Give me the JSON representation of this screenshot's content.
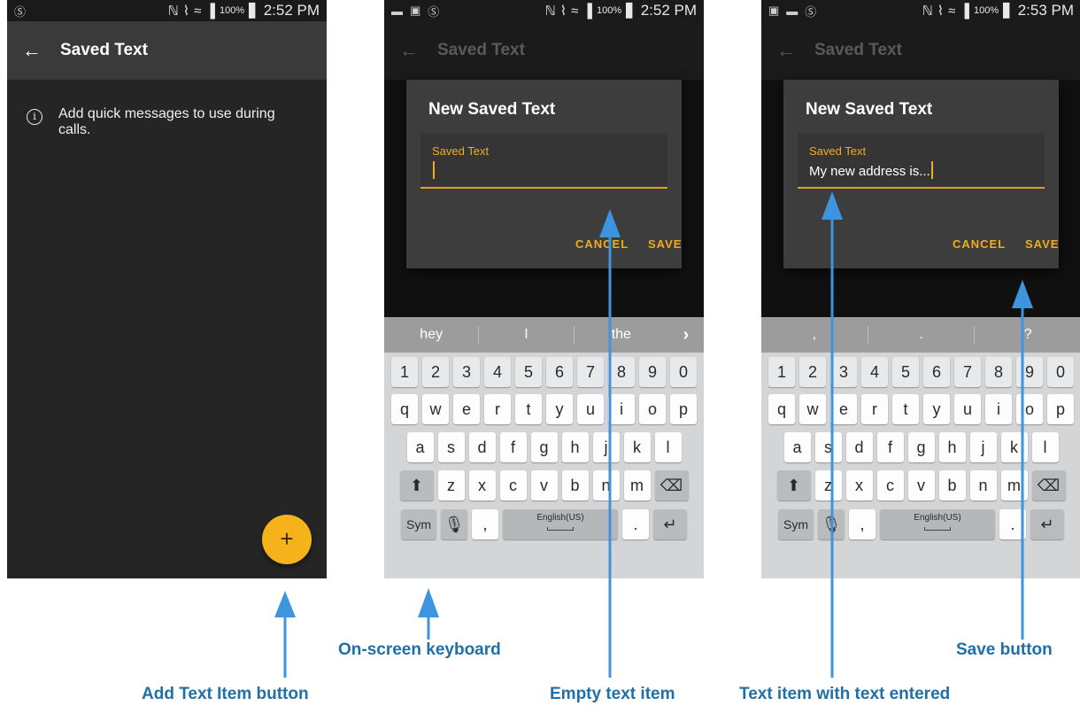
{
  "colors": {
    "accent": "#f5b21b",
    "annotation": "#3d95e0",
    "annotation_text": "#1f6fa8"
  },
  "screens": [
    {
      "status": {
        "time": "2:52 PM",
        "battery": "100%"
      },
      "appbar": {
        "back_icon": "arrow-left-icon",
        "title": "Saved Text"
      },
      "info_text": "Add quick messages to use during calls.",
      "fab_label": "+"
    },
    {
      "status": {
        "time": "2:52 PM",
        "battery": "100%"
      },
      "appbar": {
        "back_icon": "arrow-left-icon",
        "title": "Saved Text"
      },
      "dialog": {
        "title": "New Saved Text",
        "field_label": "Saved Text",
        "field_value": "",
        "cancel": "CANCEL",
        "save": "SAVE"
      },
      "suggestions": [
        "hey",
        "I",
        "the"
      ]
    },
    {
      "status": {
        "time": "2:53 PM",
        "battery": "100%"
      },
      "appbar": {
        "back_icon": "arrow-left-icon",
        "title": "Saved Text"
      },
      "dialog": {
        "title": "New Saved Text",
        "field_label": "Saved Text",
        "field_value": "My new address is...",
        "cancel": "CANCEL",
        "save": "SAVE"
      },
      "suggestions": [
        ",",
        ".",
        "?"
      ]
    }
  ],
  "keyboard": {
    "numbers": [
      "1",
      "2",
      "3",
      "4",
      "5",
      "6",
      "7",
      "8",
      "9",
      "0"
    ],
    "row1": [
      "q",
      "w",
      "e",
      "r",
      "t",
      "y",
      "u",
      "i",
      "o",
      "p"
    ],
    "row2": [
      "a",
      "s",
      "d",
      "f",
      "g",
      "h",
      "j",
      "k",
      "l"
    ],
    "row3": [
      "z",
      "x",
      "c",
      "v",
      "b",
      "n",
      "m"
    ],
    "sym": "Sym",
    "comma": ",",
    "space": "English(US)",
    "period": "."
  },
  "annotations": {
    "add_text_item_button": "Add Text Item button",
    "on_screen_keyboard": "On-screen keyboard",
    "empty_text_item": "Empty text item",
    "text_item_with_text": "Text item with text entered",
    "save_button": "Save button"
  }
}
